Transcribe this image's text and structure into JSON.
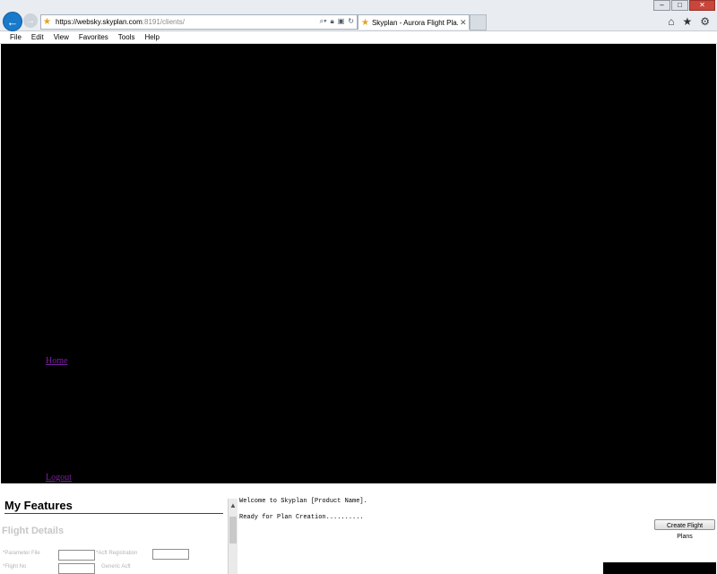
{
  "browser": {
    "url_host": "https://websky.skyplan.com",
    "url_rest": ":8191/clients/",
    "tab_title": "Skyplan - Aurora Flight Pla...",
    "tab_close": "✕",
    "back_icon": "←",
    "forward_icon": "→",
    "win_minimize": "–",
    "win_maximize": "□",
    "win_close": "✕",
    "toolbar_icons": [
      "⌂",
      "★",
      "⚙"
    ]
  },
  "menu": [
    "File",
    "Edit",
    "View",
    "Favorites",
    "Tools",
    "Help"
  ],
  "nav_links": {
    "home": "Home",
    "logout": "Logout"
  },
  "features": {
    "title": "My Features",
    "section": "Flight Details",
    "fields": {
      "parameter_file": "*Parameter File",
      "acft_registration": "*Acft Registration",
      "flight_no": "*Flight No",
      "generic_acft": "Generic Acft"
    }
  },
  "log": {
    "line1": "Welcome to Skyplan [Product Name].",
    "line2": "Ready for Plan Creation.........."
  },
  "actions": {
    "create_flight_plans": "Create Flight Plans"
  },
  "colors": {
    "panel": "#000000",
    "link_visited": "#7b1fa2",
    "ie_blue": "#1979ca"
  }
}
